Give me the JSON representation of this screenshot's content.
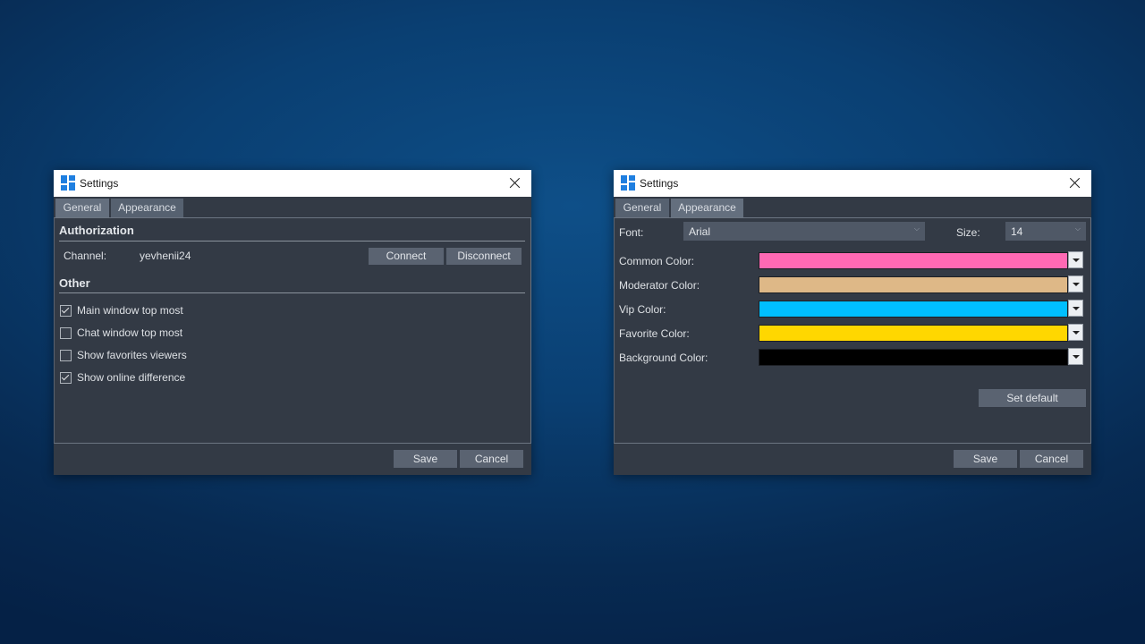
{
  "colors": {
    "common": "#ff69b4",
    "moderator": "#deb887",
    "vip": "#00bfff",
    "favorite": "#ffd700",
    "background": "#000000"
  },
  "general_window": {
    "title": "Settings",
    "tabs": [
      {
        "label": "General"
      },
      {
        "label": "Appearance"
      }
    ],
    "authorization": {
      "heading": "Authorization",
      "channel_label": "Channel:",
      "channel_value": "yevhenii24",
      "connect_label": "Connect",
      "disconnect_label": "Disconnect"
    },
    "other": {
      "heading": "Other",
      "options": [
        {
          "label": "Main window top most",
          "checked": true
        },
        {
          "label": "Chat window top most",
          "checked": false
        },
        {
          "label": "Show favorites viewers",
          "checked": false
        },
        {
          "label": "Show online difference",
          "checked": true
        }
      ]
    },
    "footer": {
      "save_label": "Save",
      "cancel_label": "Cancel"
    }
  },
  "appearance_window": {
    "title": "Settings",
    "tabs": [
      {
        "label": "General"
      },
      {
        "label": "Appearance"
      }
    ],
    "font_label": "Font:",
    "font_value": "Arial",
    "size_label": "Size:",
    "size_value": "14",
    "color_rows": [
      {
        "label": "Common Color:",
        "color": "#ff69b4"
      },
      {
        "label": "Moderator Color:",
        "color": "#deb887"
      },
      {
        "label": "Vip Color:",
        "color": "#00bfff"
      },
      {
        "label": "Favorite Color:",
        "color": "#ffd700"
      },
      {
        "label": "Background Color:",
        "color": "#000000"
      }
    ],
    "set_default_label": "Set default",
    "footer": {
      "save_label": "Save",
      "cancel_label": "Cancel"
    }
  }
}
